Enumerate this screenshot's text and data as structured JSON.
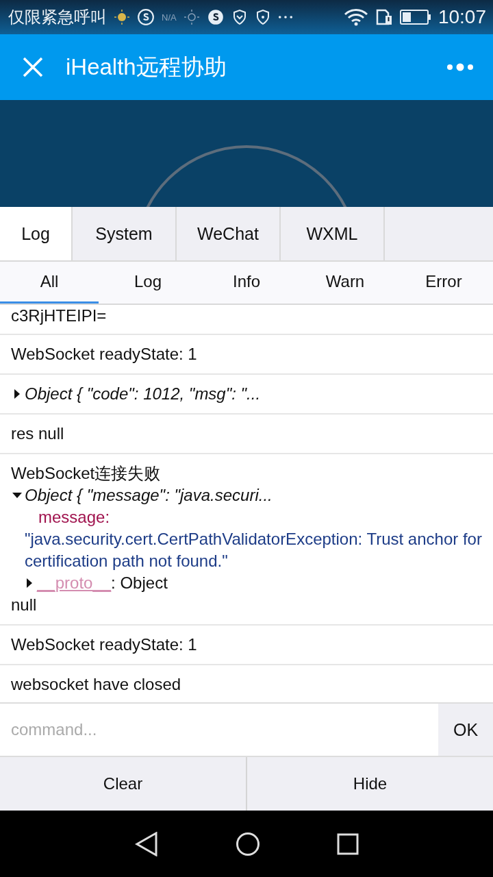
{
  "status_bar": {
    "carrier": "仅限紧急呼叫",
    "network_label": "N/A",
    "time": "10:07"
  },
  "header": {
    "title": "iHealth远程协助"
  },
  "tabs": [
    {
      "label": "Log",
      "selected": true
    },
    {
      "label": "System",
      "selected": false
    },
    {
      "label": "WeChat",
      "selected": false
    },
    {
      "label": "WXML",
      "selected": false
    }
  ],
  "filters": [
    {
      "label": "All",
      "selected": true
    },
    {
      "label": "Log",
      "selected": false
    },
    {
      "label": "Info",
      "selected": false
    },
    {
      "label": "Warn",
      "selected": false
    },
    {
      "label": "Error",
      "selected": false
    }
  ],
  "log_entries": [
    {
      "kind": "text",
      "text": "c3RjHTEIPI="
    },
    {
      "kind": "text",
      "text": "WebSocket readyState: 1"
    },
    {
      "kind": "object",
      "summary": "Object { \"code\": 1012, \"msg\": \"...",
      "expanded": false
    },
    {
      "kind": "text",
      "text": "res null"
    },
    {
      "kind": "group",
      "text": "WebSocket连接失败",
      "object": {
        "summary": "Object { \"message\": \"java.securi...",
        "expanded": true,
        "key": "message:",
        "value": "\"java.security.cert.CertPathValidatorException: Trust anchor for certification path not found.\"",
        "proto_key": "__proto__",
        "proto_value": ": Object",
        "proto_expanded": false
      },
      "after": "null"
    },
    {
      "kind": "text",
      "text": "WebSocket readyState: 1"
    },
    {
      "kind": "text",
      "text": "websocket have closed"
    }
  ],
  "command": {
    "placeholder": "command...",
    "button": "OK"
  },
  "footer_buttons": [
    "Clear",
    "Hide"
  ]
}
